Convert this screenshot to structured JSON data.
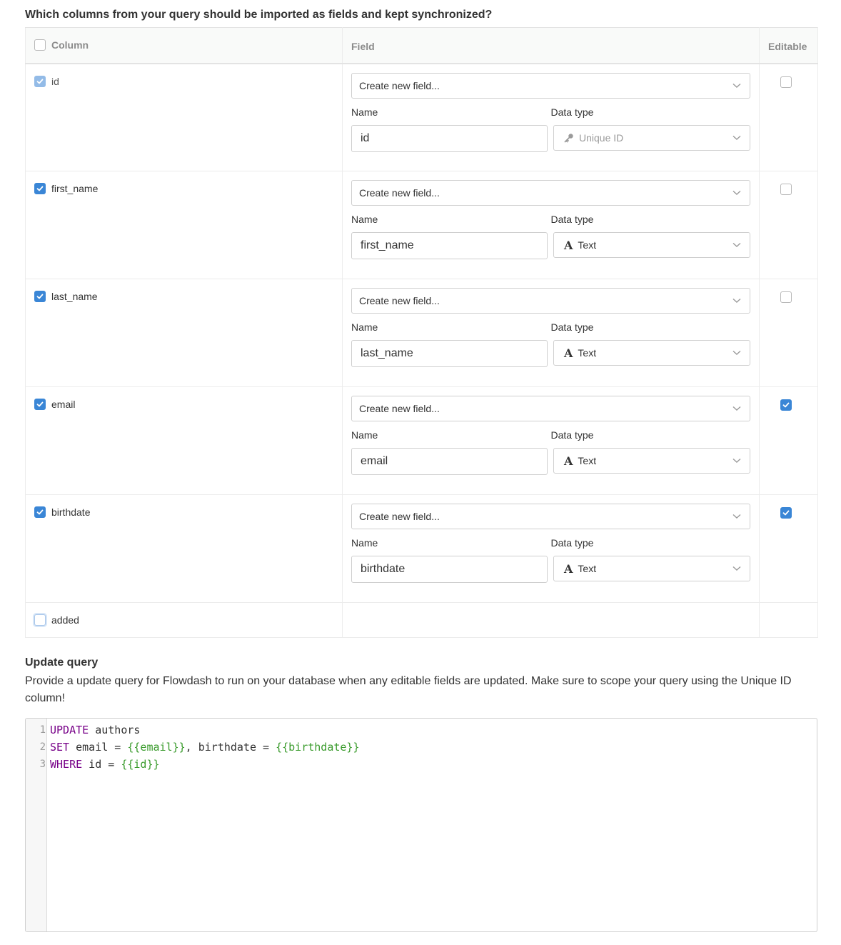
{
  "heading": "Which columns from your query should be imported as fields and kept synchronized?",
  "table": {
    "headers": {
      "column": "Column",
      "field": "Field",
      "editable": "Editable"
    },
    "rows": [
      {
        "column": "id",
        "selected": true,
        "field_select": "Create new field...",
        "name_label": "Name",
        "type_label": "Data type",
        "name_value": "id",
        "data_type": "Unique ID",
        "data_type_icon": "key-icon",
        "editable": false
      },
      {
        "column": "first_name",
        "selected": true,
        "field_select": "Create new field...",
        "name_label": "Name",
        "type_label": "Data type",
        "name_value": "first_name",
        "data_type": "Text",
        "data_type_icon": "A",
        "editable": false
      },
      {
        "column": "last_name",
        "selected": true,
        "field_select": "Create new field...",
        "name_label": "Name",
        "type_label": "Data type",
        "name_value": "last_name",
        "data_type": "Text",
        "data_type_icon": "A",
        "editable": false
      },
      {
        "column": "email",
        "selected": true,
        "field_select": "Create new field...",
        "name_label": "Name",
        "type_label": "Data type",
        "name_value": "email",
        "data_type": "Text",
        "data_type_icon": "A",
        "editable": true
      },
      {
        "column": "birthdate",
        "selected": true,
        "field_select": "Create new field...",
        "name_label": "Name",
        "type_label": "Data type",
        "name_value": "birthdate",
        "data_type": "Text",
        "data_type_icon": "A",
        "editable": true
      },
      {
        "column": "added",
        "selected": false
      }
    ]
  },
  "update_query": {
    "title": "Update query",
    "description": "Provide a update query for Flowdash to run on your database when any editable fields are updated. Make sure to scope your query using the Unique ID column!",
    "lines": [
      {
        "num": "1",
        "kw": "UPDATE",
        "rest": " authors"
      },
      {
        "num": "2",
        "kw": "SET",
        "a": " email = ",
        "v1": "{{email}}",
        "b": ", birthdate = ",
        "v2": "{{birthdate}}"
      },
      {
        "num": "3",
        "kw": "WHERE",
        "a": " id = ",
        "v1": "{{id}}"
      }
    ]
  },
  "colors": {
    "accent": "#3a86d6",
    "keyword": "#770088",
    "template_var": "#3a9b2c"
  }
}
